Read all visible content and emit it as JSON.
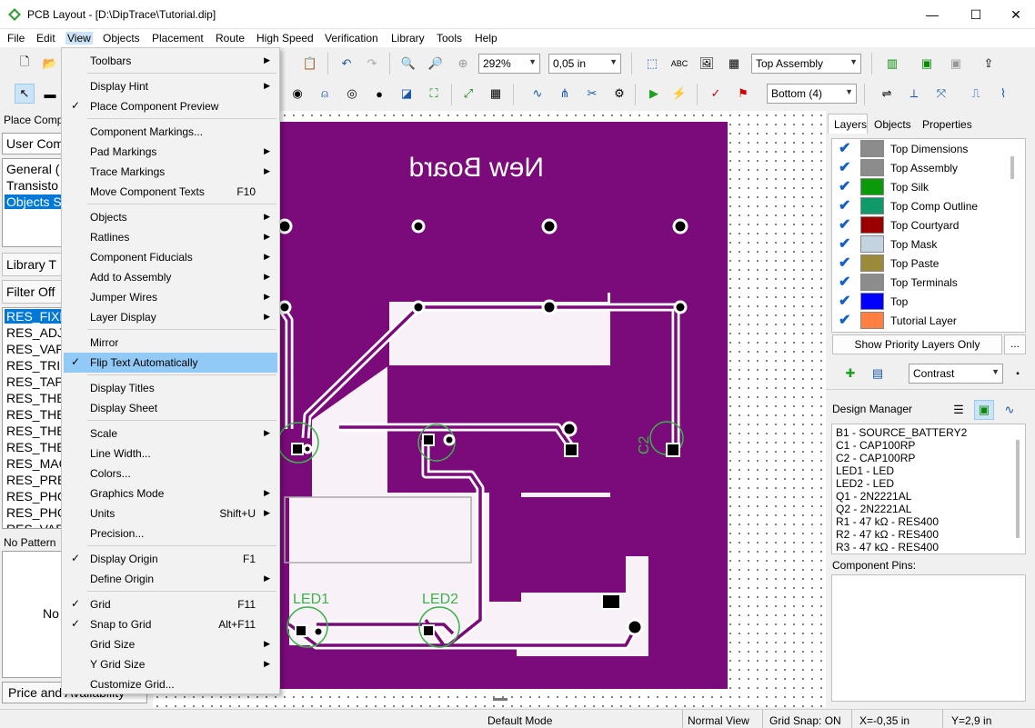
{
  "window": {
    "title": "PCB Layout - [D:\\DipTrace\\Tutorial.dip]",
    "minimize": "—",
    "maximize": "☐",
    "close": "✕"
  },
  "menubar": [
    "File",
    "Edit",
    "View",
    "Objects",
    "Placement",
    "Route",
    "High Speed",
    "Verification",
    "Library",
    "Tools",
    "Help"
  ],
  "toolbar": {
    "zoom": "292%",
    "grid": "0,05 in",
    "assembly_layer": "Top Assembly",
    "route_layer": "Bottom (4)"
  },
  "left_panel": {
    "place_component": "Place Comp",
    "user_comp": "User Com",
    "groups": [
      "General (",
      "Transisto",
      "Objects S"
    ],
    "library_tab": "Library T",
    "filter": "Filter Off",
    "components": [
      "RES_FIXE",
      "RES_ADJU",
      "RES_VAR",
      "RES_TRIM",
      "RES_TAP",
      "RES_THE",
      "RES_THE",
      "RES_THE",
      "RES_THE",
      "RES_MAG",
      "RES_PRES",
      "RES_PHO",
      "RES_PHO",
      "RES_VAR"
    ],
    "no_pattern": "No Pattern",
    "no_label": "No",
    "price": "Price and Availability"
  },
  "view_menu": [
    {
      "label": "Toolbars",
      "sub": true
    },
    {
      "sep": true
    },
    {
      "label": "Display Hint",
      "sub": true
    },
    {
      "label": "Place Component Preview",
      "check": true
    },
    {
      "sep": true
    },
    {
      "label": "Component Markings..."
    },
    {
      "label": "Pad Markings",
      "sub": true
    },
    {
      "label": "Trace Markings",
      "sub": true
    },
    {
      "label": "Move Component Texts",
      "shortcut": "F10"
    },
    {
      "sep": true
    },
    {
      "label": "Objects",
      "sub": true
    },
    {
      "label": "Ratlines",
      "sub": true
    },
    {
      "label": "Component Fiducials",
      "sub": true
    },
    {
      "label": "Add to Assembly",
      "sub": true
    },
    {
      "label": "Jumper Wires",
      "sub": true
    },
    {
      "label": "Layer Display",
      "sub": true
    },
    {
      "sep": true
    },
    {
      "label": "Mirror"
    },
    {
      "label": "Flip Text Automatically",
      "check": true,
      "highlight": true
    },
    {
      "sep": true
    },
    {
      "label": "Display Titles"
    },
    {
      "label": "Display Sheet"
    },
    {
      "sep": true
    },
    {
      "label": "Scale",
      "sub": true
    },
    {
      "label": "Line Width..."
    },
    {
      "label": "Colors..."
    },
    {
      "label": "Graphics Mode",
      "sub": true
    },
    {
      "label": "Units",
      "shortcut": "Shift+U",
      "sub": true
    },
    {
      "label": "Precision..."
    },
    {
      "sep": true
    },
    {
      "label": "Display Origin",
      "shortcut": "F1",
      "check": true
    },
    {
      "label": "Define Origin",
      "sub": true
    },
    {
      "sep": true
    },
    {
      "label": "Grid",
      "shortcut": "F11",
      "check": true
    },
    {
      "label": "Snap to Grid",
      "shortcut": "Alt+F11",
      "check": true
    },
    {
      "label": "Grid Size",
      "sub": true
    },
    {
      "label": "Y Grid Size",
      "sub": true
    },
    {
      "label": "Customize Grid..."
    }
  ],
  "board": {
    "title": "New Board",
    "labels": [
      "C2",
      "LED1",
      "LED2"
    ],
    "board_color": "#7b0a7b",
    "silk_color": "#3cb34a"
  },
  "right_panel": {
    "tabs": [
      "Layers",
      "Objects",
      "Properties"
    ],
    "layers": [
      {
        "name": "Top Dimensions",
        "color": "#8c8c8c"
      },
      {
        "name": "Top Assembly",
        "color": "#8c8c8c"
      },
      {
        "name": "Top Silk",
        "color": "#0a9a0a"
      },
      {
        "name": "Top Comp Outline",
        "color": "#0f9a6a"
      },
      {
        "name": "Top Courtyard",
        "color": "#9a0000"
      },
      {
        "name": "Top Mask",
        "color": "#c3d3e0"
      },
      {
        "name": "Top Paste",
        "color": "#9a8a3a"
      },
      {
        "name": "Top Terminals",
        "color": "#8c8c8c"
      },
      {
        "name": "Top",
        "color": "#0000ff"
      },
      {
        "name": "Tutorial Layer",
        "color": "#ff8040"
      }
    ],
    "priority_button": "Show Priority Layers Only",
    "more_button": "...",
    "contrast": "Contrast",
    "design_manager": "Design Manager",
    "components": [
      "B1 - SOURCE_BATTERY2",
      "C1 - CAP100RP",
      "C2 - CAP100RP",
      "LED1 - LED",
      "LED2 - LED",
      "Q1 - 2N2221AL",
      "Q2 - 2N2221AL",
      "R1 - 47 kΩ - RES400",
      "R2 - 47 kΩ - RES400",
      "R3 - 47 kΩ - RES400"
    ],
    "component_pins": "Component Pins:"
  },
  "status": {
    "mode": "Default Mode",
    "view": "Normal View",
    "snap": "Grid Snap: ON",
    "x": "X=-0,35 in",
    "y": "Y=2,9 in"
  }
}
